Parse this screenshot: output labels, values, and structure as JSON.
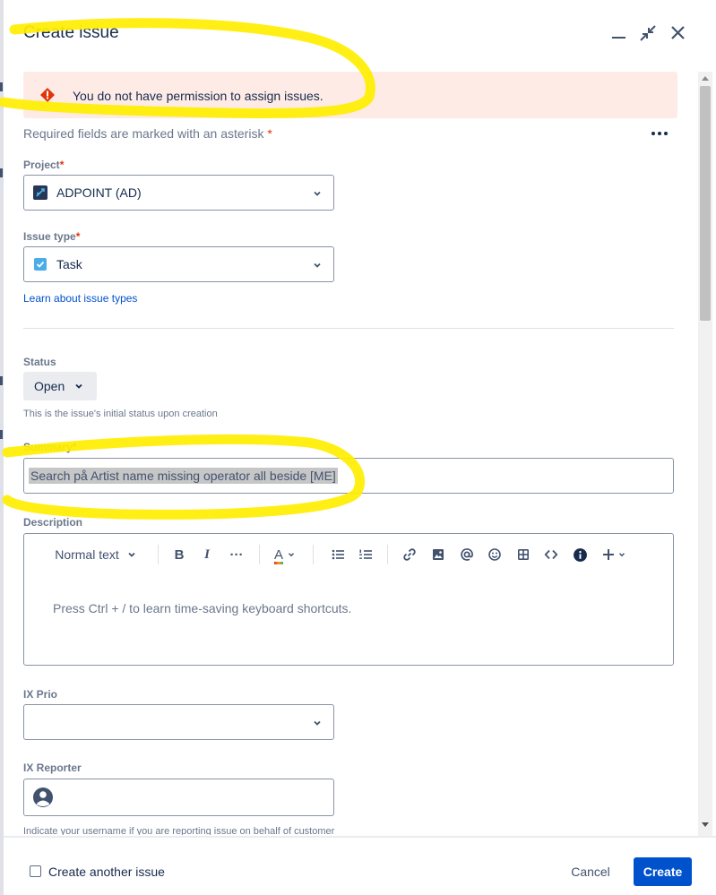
{
  "header": {
    "title": "Create issue"
  },
  "error_banner": {
    "message": "You do not have permission to assign issues."
  },
  "form": {
    "required_note": "Required fields are marked with an asterisk",
    "asterisk": "*",
    "project": {
      "label": "Project",
      "value": "ADPOINT (AD)"
    },
    "issue_type": {
      "label": "Issue type",
      "value": "Task",
      "link": "Learn about issue types"
    },
    "status": {
      "label": "Status",
      "value": "Open",
      "help": "This is the issue's initial status upon creation"
    },
    "summary": {
      "label": "Summary",
      "value": "Search på Artist name missing operator all beside [ME]"
    },
    "description": {
      "label": "Description",
      "toolbar": {
        "text_style": "Normal text",
        "bold": "B",
        "italic": "I",
        "more": "···",
        "text_color": "A"
      },
      "placeholder": "Press Ctrl + / to learn time-saving keyboard shortcuts."
    },
    "ix_prio": {
      "label": "IX Prio",
      "value": ""
    },
    "ix_reporter": {
      "label": "IX Reporter",
      "value": "",
      "help": "Indicate your username if you are reporting issue on behalf of customer"
    }
  },
  "footer": {
    "create_another": "Create another issue",
    "cancel": "Cancel",
    "create": "Create"
  },
  "colors": {
    "primary": "#0052cc",
    "error_bg": "#ffebe6",
    "error_icon": "#de350b",
    "highlight": "#ffee00"
  }
}
